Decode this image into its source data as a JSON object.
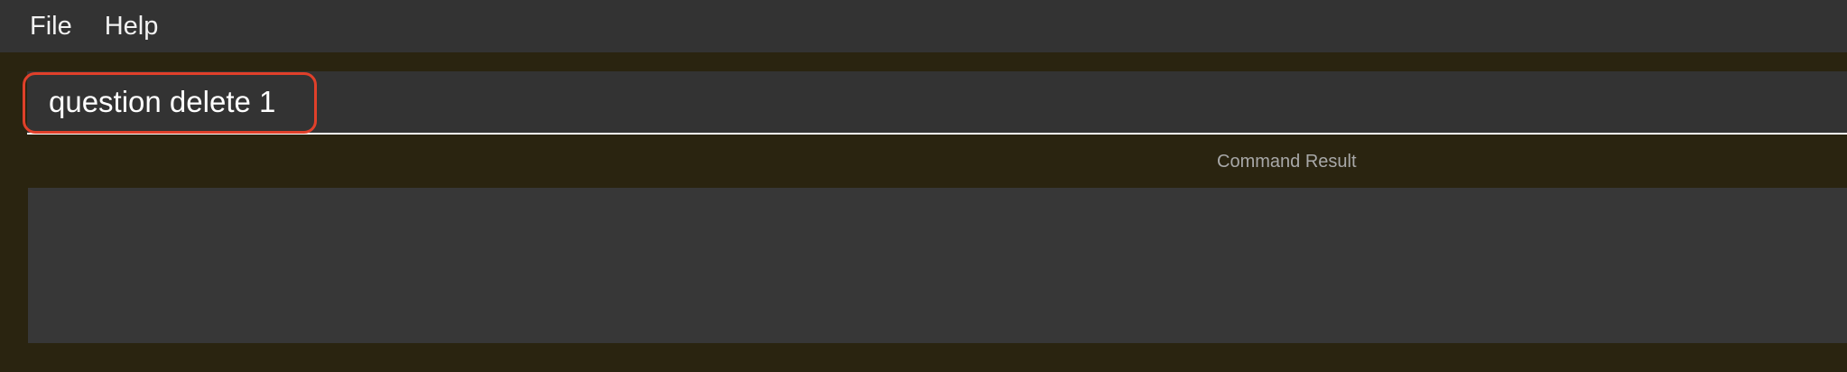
{
  "menubar": {
    "items": [
      {
        "label": "File"
      },
      {
        "label": "Help"
      }
    ]
  },
  "command": {
    "value": "question delete 1"
  },
  "result": {
    "label": "Command Result",
    "text": ""
  },
  "colors": {
    "background": "#2a2410",
    "panel": "#333333",
    "result_panel": "#373737",
    "highlight": "#e0402a"
  }
}
